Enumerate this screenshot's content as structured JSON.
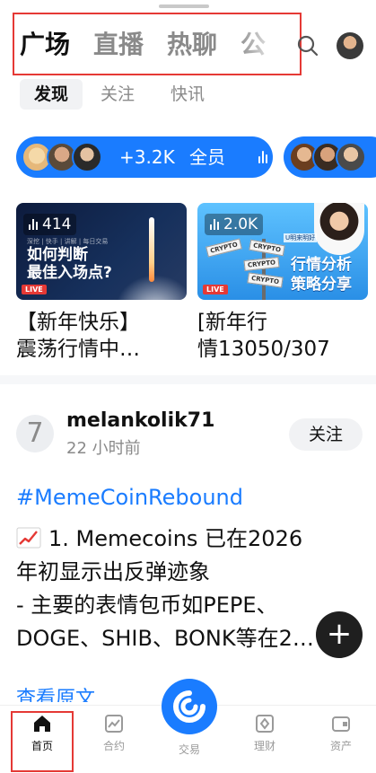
{
  "top_tabs": [
    "广场",
    "直播",
    "热聊",
    "公"
  ],
  "sub_tabs": [
    "发现",
    "关注",
    "快讯"
  ],
  "live_pill": {
    "count": "+3.2K",
    "label": "全员"
  },
  "live_cards": [
    {
      "viewers": "414",
      "badge": "LIVE",
      "tags": "深挖 | 快手 | 讲解 | 每日交易",
      "headline_1": "如何判断",
      "headline_2": "最佳入场点?",
      "title_1": "【新年快乐】",
      "title_2": "震荡行情中…"
    },
    {
      "viewers": "2.0K",
      "badge": "LIVE",
      "host_label": "U明来明好",
      "sign_text": "CRYPTO",
      "headline_1": "行情分析",
      "headline_2": "策略分享",
      "title_1": "[新年行",
      "title_2": "情13050/307"
    }
  ],
  "post": {
    "avatar_text": "7",
    "username": "melankolik71",
    "time": "22 小时前",
    "follow_label": "关注",
    "hashtag": "#MemeCoinRebound",
    "lines": [
      "1. Memecoins 已在2026",
      "年初显示出反弹迹象",
      "- 主要的表情包币如PEPE、",
      "DOGE、SHIB、BONK等在2…"
    ],
    "read_more": "查看原文"
  },
  "fab_label": "+",
  "bottom_nav": {
    "home": "首页",
    "contracts": "合约",
    "trade": "交易",
    "finance": "理财",
    "assets": "资产"
  },
  "colors": {
    "accent": "#1a7cff",
    "highlight_box": "#e53935"
  }
}
